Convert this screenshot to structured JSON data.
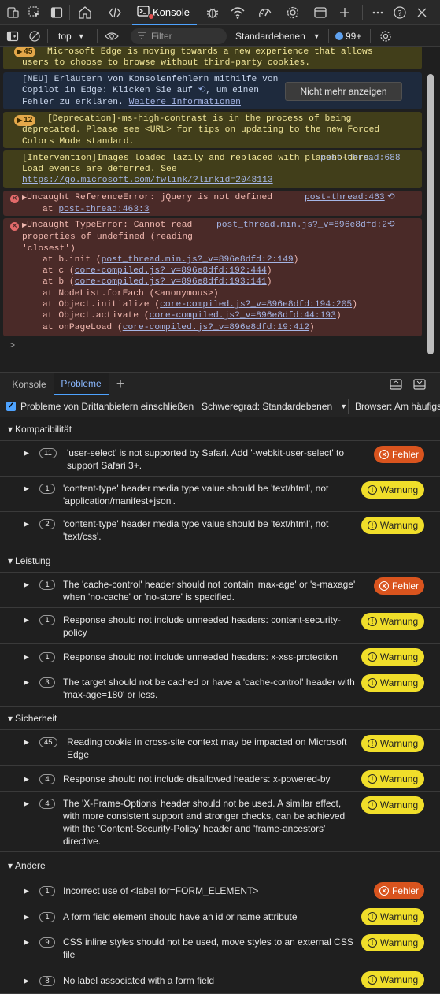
{
  "toolbar": {
    "console_tab_label": "Konsole",
    "icons": [
      "device-emulation-icon",
      "toggle-screencast-icon",
      "dock-icon",
      "home-icon",
      "elements-icon",
      "console-icon",
      "bug-icon",
      "network-icon",
      "performance-icon",
      "settings-icon",
      "application-icon",
      "add-tab-icon",
      "more-icon",
      "help-icon",
      "close-icon"
    ]
  },
  "console_toolbar": {
    "context": "top",
    "filter_placeholder": "Filter",
    "levels": "Standardebenen",
    "issues_count": "99+"
  },
  "messages": {
    "m1": {
      "badge": "45",
      "text": "Microsoft Edge is moving towards a new experience that allows users to choose to browse without third-party cookies."
    },
    "m2": {
      "line1": "[NEU] Erläutern von Konsolenfehlern mithilfe von",
      "line2a": "Copilot in Edge: Klicken Sie auf",
      "line2b": ", um einen",
      "line3": "Fehler zu erklären.",
      "link": "Weitere Informationen",
      "button": "Nicht mehr anzeigen"
    },
    "m3": {
      "badge": "12",
      "text": "[Deprecation]-ms-high-contrast is in the process of being deprecated. Please see <URL> for tips on updating to the new Forced Colors Mode standard."
    },
    "m4": {
      "text": "[Intervention]Images loaded lazily and replaced with placeholders. Load events are deferred. See",
      "url": "https://go.microsoft.com/fwlink/?linkid=2048113",
      "source": "post-thread:688"
    },
    "m5": {
      "text": "Uncaught ReferenceError: jQuery is not defined",
      "at": "at",
      "at_link": "post-thread:463:3",
      "source": "post-thread:463"
    },
    "m6": {
      "text": "Uncaught TypeError: Cannot read properties of undefined (reading 'closest')",
      "source": "post_thread.min.js?_v=896e8dfd:2",
      "stack": [
        {
          "prefix": "at b.init (",
          "link": "post_thread.min.js?_v=896e8dfd:2:149",
          "suffix": ")"
        },
        {
          "prefix": "at c (",
          "link": "core-compiled.js?_v=896e8dfd:192:444",
          "suffix": ")"
        },
        {
          "prefix": "at b (",
          "link": "core-compiled.js?_v=896e8dfd:193:141",
          "suffix": ")"
        },
        {
          "prefix": "at NodeList.forEach (<anonymous>)",
          "link": "",
          "suffix": ""
        },
        {
          "prefix": "at Object.initialize (",
          "link": "core-compiled.js?_v=896e8dfd:194:205",
          "suffix": ")"
        },
        {
          "prefix": "at Object.activate (",
          "link": "core-compiled.js?_v=896e8dfd:44:193",
          "suffix": ")"
        },
        {
          "prefix": "at onPageLoad (",
          "link": "core-compiled.js?_v=896e8dfd:19:412",
          "suffix": ")"
        }
      ]
    },
    "prompt": ">"
  },
  "drawer": {
    "tab_console": "Konsole",
    "tab_issues": "Probleme",
    "add": "+"
  },
  "issues_toolbar": {
    "checkbox_label": "Probleme von Drittanbietern einschließen",
    "severity": "Schweregrad: Standardebenen",
    "browser": "Browser: Am häufigsten"
  },
  "categories": {
    "kompat": {
      "label": "Kompatibilität",
      "rows": [
        {
          "count": "11",
          "text1": "'user-select' is not supported by Safari. Add '-webkit-user-select' to",
          "text2": "support Safari 3+.",
          "level": "Fehler"
        },
        {
          "count": "1",
          "text1": "'content-type' header media type value should be 'text/html', not",
          "text2": "'application/manifest+json'.",
          "level": "Warnung"
        },
        {
          "count": "2",
          "text1": "'content-type' header media type value should be 'text/html', not",
          "text2": "'text/css'.",
          "level": "Warnung"
        }
      ]
    },
    "leistung": {
      "label": "Leistung",
      "rows": [
        {
          "count": "1",
          "text1": "The 'cache-control' header should not contain 'max-age' or 's-maxage'",
          "text2": "when 'no-cache' or 'no-store' is specified.",
          "level": "Fehler"
        },
        {
          "count": "1",
          "text1": "Response should not include unneeded headers: content-security-",
          "text2": "policy",
          "level": "Warnung"
        },
        {
          "count": "1",
          "text1": "Response should not include unneeded headers: x-xss-protection",
          "text2": "",
          "level": "Warnung"
        },
        {
          "count": "3",
          "text1": "The target should not be cached or have a 'cache-control' header with",
          "text2": "'max-age=180' or less.",
          "level": "Warnung"
        }
      ]
    },
    "sicherheit": {
      "label": "Sicherheit",
      "rows": [
        {
          "count": "45",
          "text1": "Reading cookie in cross-site context may be impacted on Microsoft",
          "text2": "Edge",
          "level": "Warnung"
        },
        {
          "count": "4",
          "text1": "Response should not include disallowed headers: x-powered-by",
          "text2": "",
          "level": "Warnung"
        },
        {
          "count": "4",
          "text1": "The 'X-Frame-Options' header should not be used. A similar effect,",
          "text2": "with more consistent support and stronger checks, can be achieved",
          "text3": "with the 'Content-Security-Policy' header and 'frame-ancestors'",
          "text4": "directive.",
          "level": "Warnung"
        }
      ]
    },
    "andere": {
      "label": "Andere",
      "rows": [
        {
          "count": "1",
          "text1": "Incorrect use of <label for=FORM_ELEMENT>",
          "text2": "",
          "level": "Fehler"
        },
        {
          "count": "1",
          "text1": "A form field element should have an id or name attribute",
          "text2": "",
          "level": "Warnung"
        },
        {
          "count": "9",
          "text1": "CSS inline styles should not be used, move styles to an external CSS",
          "text2": "file",
          "level": "Warnung"
        },
        {
          "count": "8",
          "text1": "No label associated with a form field",
          "text2": "",
          "level": "Warnung"
        }
      ]
    }
  },
  "colors": {
    "warning_pill": "#f0de2a",
    "error_pill": "#d9541e",
    "accent": "#4ea3ff"
  }
}
